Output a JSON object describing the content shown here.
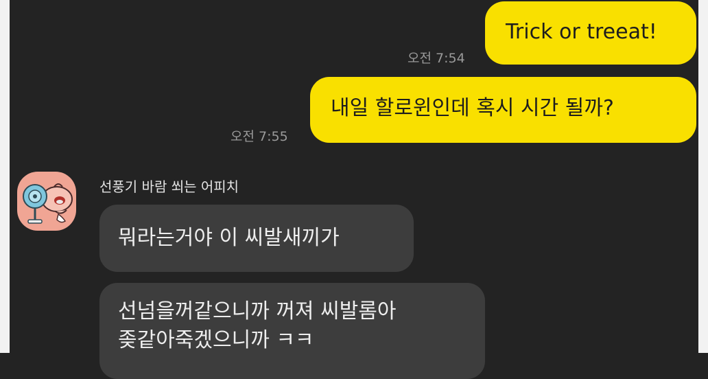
{
  "chat": {
    "outgoing": [
      {
        "text": "Trick or treeat!",
        "time": "오전 7:54"
      },
      {
        "text": "내일 할로윈인데 혹시 시간 될까?",
        "time": "오전 7:55"
      }
    ],
    "incoming": {
      "sender": "선풍기 바람 쐬는 어피치",
      "messages": [
        "뭐라는거야 이 씨발새끼가",
        "선넘을꺼같으니까 꺼져 씨발롬아",
        "좆같아죽겠으니까 ㅋㅋ"
      ]
    }
  },
  "colors": {
    "background": "#232323",
    "outgoing_bubble": "#f9e000",
    "incoming_bubble": "#3d3d3d",
    "timestamp": "#9a9a9a"
  }
}
